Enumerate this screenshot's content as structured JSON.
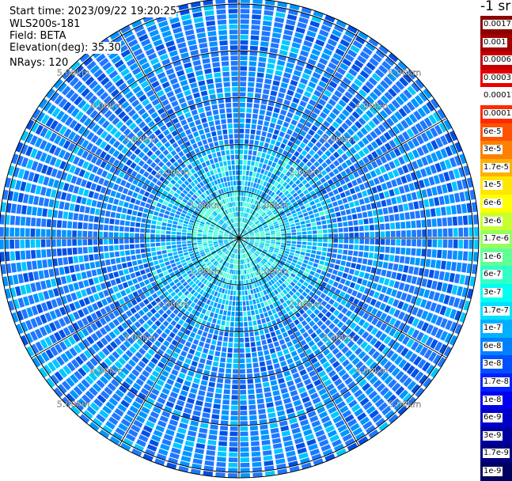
{
  "header": {
    "start_time": "Start time: 2023/09/22 19:20:25",
    "instrument": "WLS200s-181",
    "field": "Field: BETA",
    "elevation": "Elevation(deg): 35.30",
    "nrays": "NRays: 120"
  },
  "colorbar": {
    "unit_label": "-1 sr",
    "levels": [
      {
        "label": "0.0017",
        "color": "#8b0000"
      },
      {
        "label": "0.001",
        "color": "#a40000"
      },
      {
        "label": "0.0006",
        "color": "#c40000"
      },
      {
        "label": "0.0003",
        "color": "#e80000"
      },
      {
        "label": "0.00017",
        "color": "#ffffff"
      },
      {
        "label": "0.0001",
        "color": "#ff2a00"
      },
      {
        "label": "6e-5",
        "color": "#ff5200"
      },
      {
        "label": "3e-5",
        "color": "#ff8000"
      },
      {
        "label": "1.7e-5",
        "color": "#ffb000"
      },
      {
        "label": "1e-5",
        "color": "#ffe600"
      },
      {
        "label": "6e-6",
        "color": "#ffff00"
      },
      {
        "label": "3e-6",
        "color": "#c8ff30"
      },
      {
        "label": "1.7e-6",
        "color": "#96ff60"
      },
      {
        "label": "1e-6",
        "color": "#60ff96"
      },
      {
        "label": "6e-7",
        "color": "#30ffc8"
      },
      {
        "label": "3e-7",
        "color": "#00fff0"
      },
      {
        "label": "1.7e-7",
        "color": "#00e0ff"
      },
      {
        "label": "1e-7",
        "color": "#00b0ff"
      },
      {
        "label": "6e-8",
        "color": "#0080ff"
      },
      {
        "label": "3e-8",
        "color": "#0050ff"
      },
      {
        "label": "1.7e-8",
        "color": "#0020ff"
      },
      {
        "label": "1e-8",
        "color": "#0000f0"
      },
      {
        "label": "6e-9",
        "color": "#0000c8"
      },
      {
        "label": "3e-9",
        "color": "#0000a0"
      },
      {
        "label": "1.7e-9",
        "color": "#000080"
      },
      {
        "label": "1e-9",
        "color": "#000060"
      }
    ]
  },
  "chart_data": {
    "type": "heatmap",
    "projection": "polar-ppi",
    "field": "BETA",
    "n_rays": 120,
    "max_range_km": 5.15,
    "range_rings_km": [
      1,
      2,
      3,
      4,
      5
    ],
    "range_ring_labels": [
      "1.00km",
      "2.00km",
      "3.00km",
      "4.00km",
      "5.00km"
    ],
    "azimuth_spokes_deg": [
      0,
      30,
      60,
      90,
      120,
      150,
      180,
      210,
      240,
      270,
      300,
      330
    ],
    "background_value_range": [
      "3e-8",
      "6e-7"
    ],
    "dominant_colors": [
      "#1e78ff",
      "#0096ff",
      "#00c8ff",
      "#4bffd7",
      "#0050e6"
    ]
  }
}
